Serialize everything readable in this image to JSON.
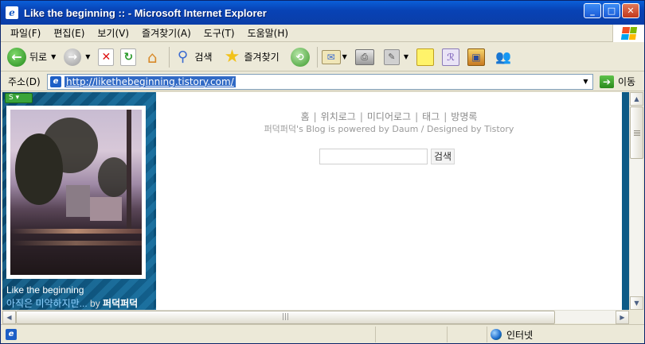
{
  "window": {
    "title": "Like the beginning :: - Microsoft Internet Explorer",
    "buttons": [
      "_",
      "□",
      "✕"
    ]
  },
  "menu": {
    "items": [
      "파일(F)",
      "편집(E)",
      "보기(V)",
      "즐겨찾기(A)",
      "도구(T)",
      "도움말(H)"
    ]
  },
  "toolbar": {
    "back_label": "뒤로",
    "search_label": "검색",
    "favorites_label": "즐겨찾기"
  },
  "address": {
    "label": "주소(D)",
    "url": "http://likethebeginning.tistory.com/",
    "go_label": "이동"
  },
  "sidebar": {
    "blog_title": "Like the beginning",
    "subtitle": "아직은 미약하지만...",
    "by": "by",
    "author": "퍼덕퍼덕"
  },
  "main": {
    "nav": [
      "홈",
      "위치로그",
      "미디어로그",
      "태그",
      "방명록"
    ],
    "powered": "퍼덕퍼덕's Blog is powered by Daum / Designed by Tistory",
    "search_button": "검색"
  },
  "status": {
    "zone": "인터넷"
  },
  "colors": {
    "titlebar": "#0a5fd8",
    "sidebar_bg": "#0d5a86",
    "url_highlight": "#316ac5"
  }
}
